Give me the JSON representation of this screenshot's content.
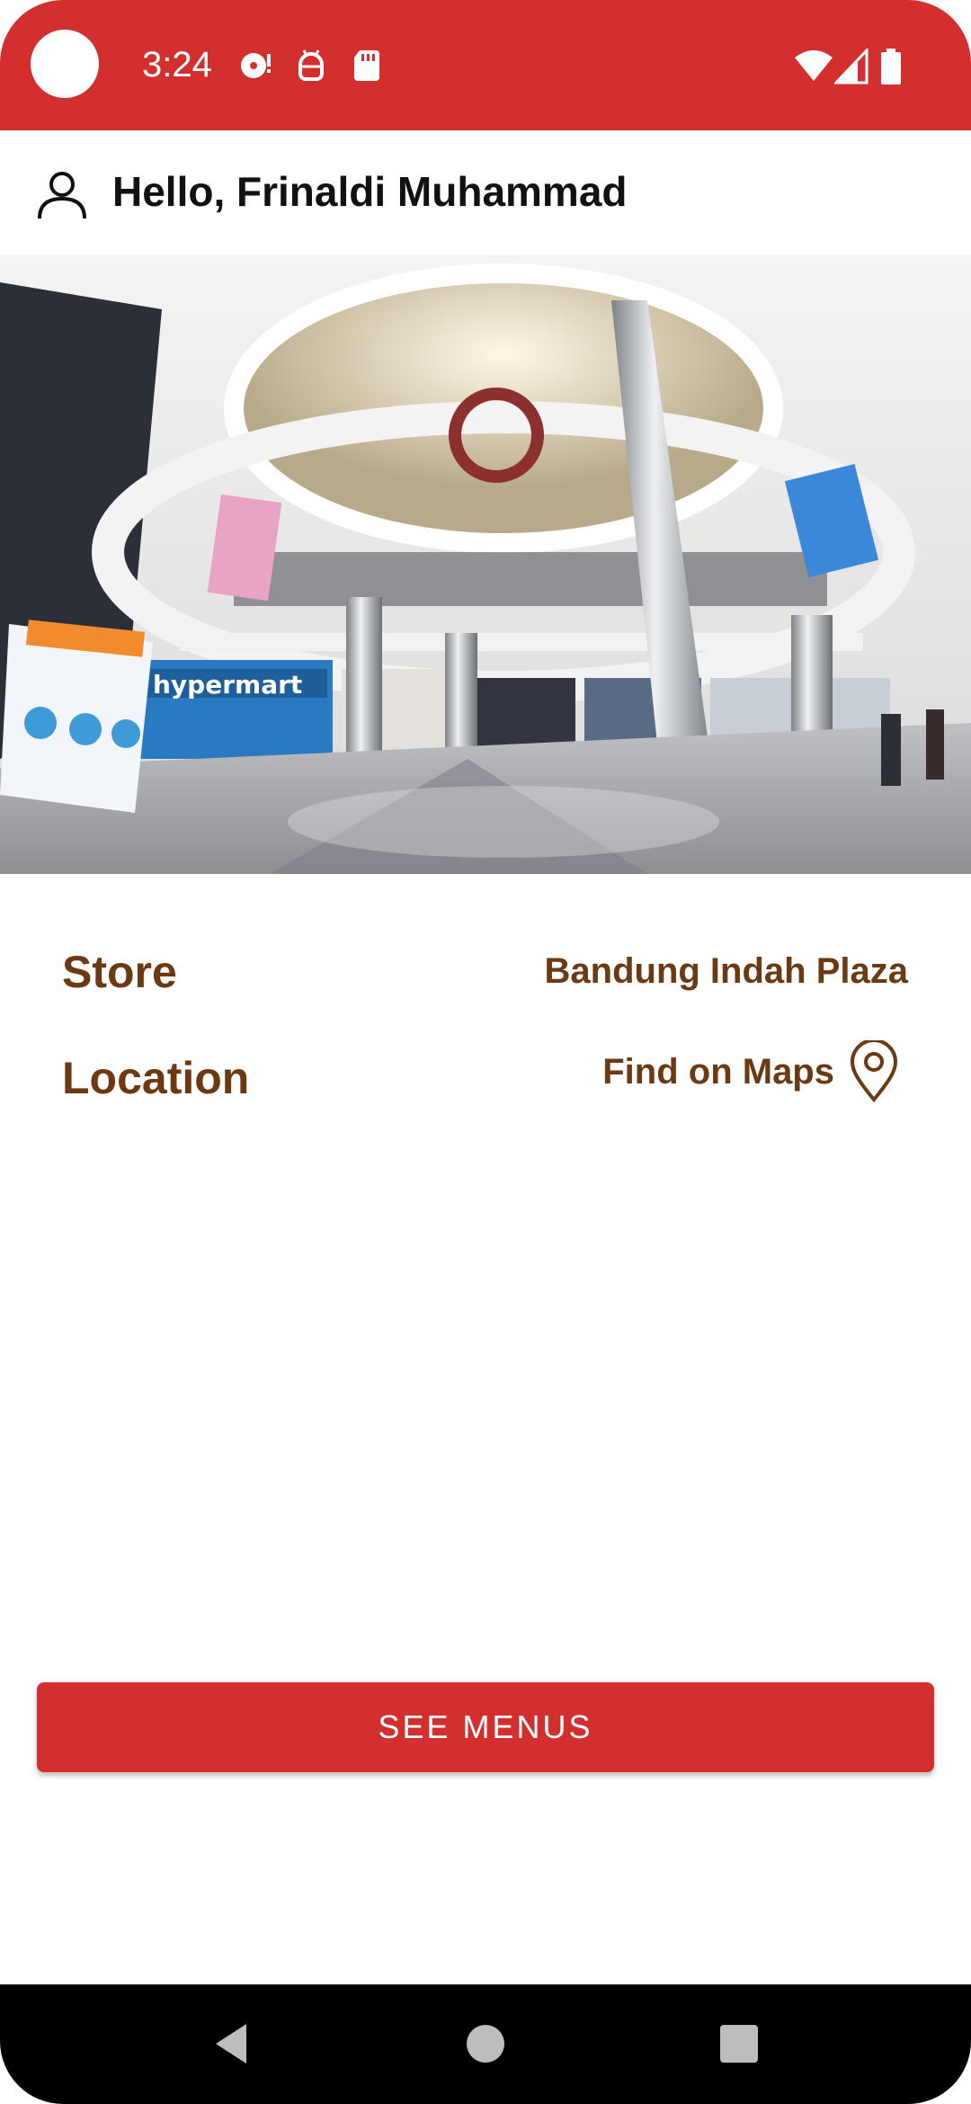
{
  "status_bar": {
    "time": "3:24",
    "left_icons": [
      "media-icon",
      "android-debug-icon",
      "sd-card-icon"
    ],
    "right_icons": [
      "wifi-icon",
      "cellular-signal-icon",
      "battery-icon"
    ],
    "color": "#d32f2f"
  },
  "header": {
    "greeting": "Hello, Frinaldi Muhammad",
    "icon": "user-icon"
  },
  "hero": {
    "image": "mall-interior-photo",
    "signage_text": "hypermart"
  },
  "store": {
    "label": "Store",
    "value": "Bandung Indah Plaza"
  },
  "location": {
    "label": "Location",
    "link_text": "Find on Maps",
    "icon": "map-pin-icon"
  },
  "action": {
    "see_menus_label": "SEE MENUS"
  },
  "nav_bar": {
    "buttons": [
      "back-icon",
      "home-icon",
      "recents-icon"
    ]
  },
  "colors": {
    "brand_red": "#d32f2f",
    "accent_brown": "#6b3a12"
  }
}
